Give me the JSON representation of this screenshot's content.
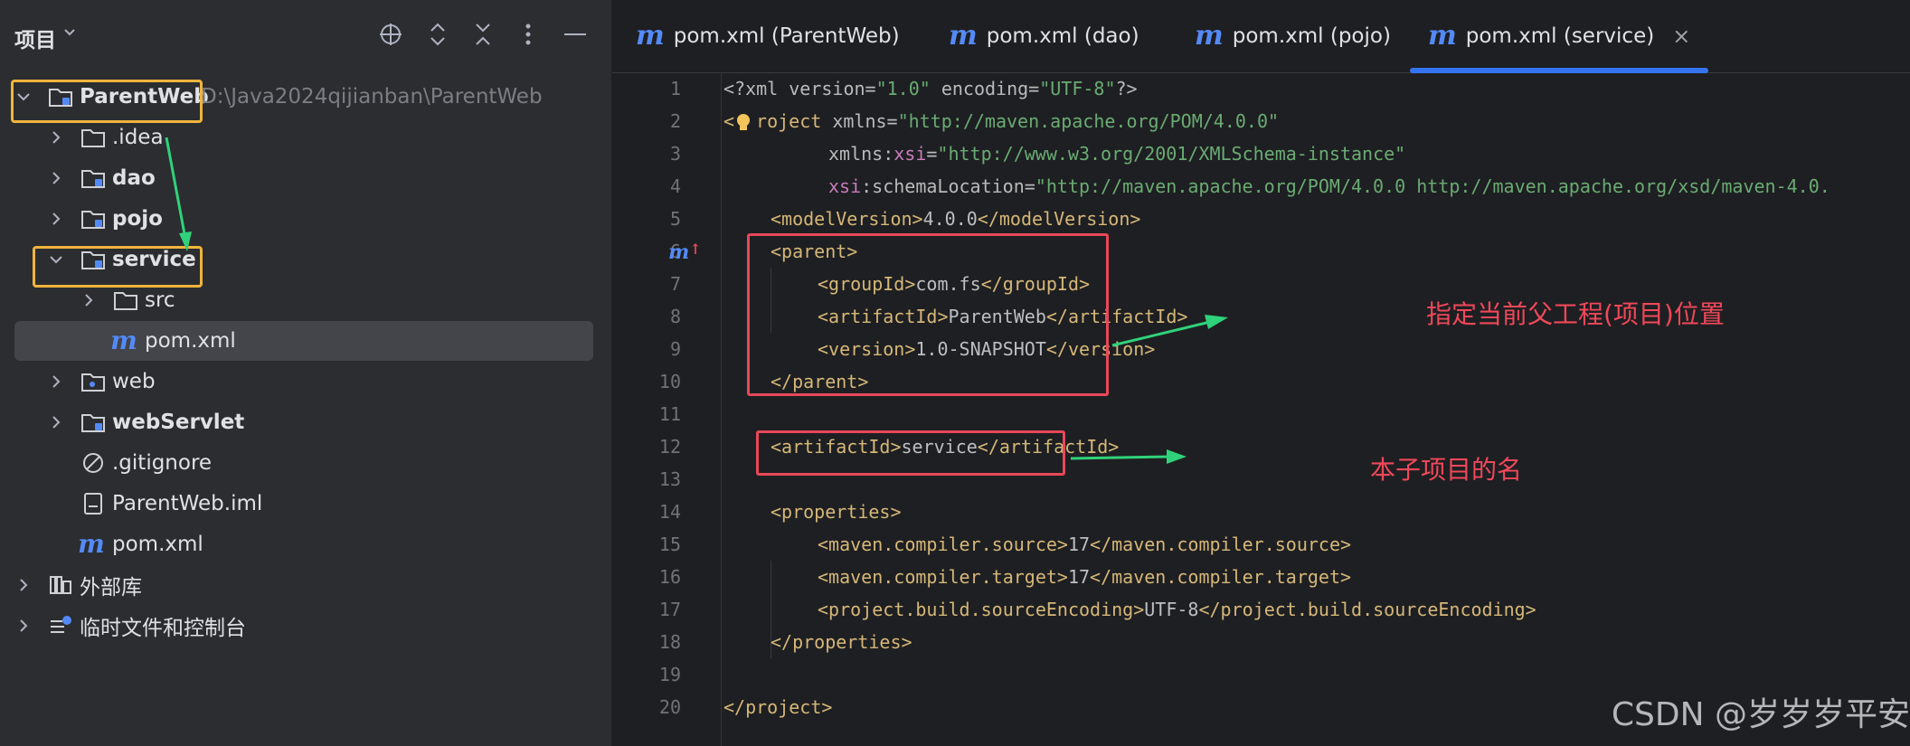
{
  "project_panel": {
    "title": "项目",
    "tree": [
      {
        "label": "ParentWeb",
        "path": "D:\\Java2024qijianban\\ParentWeb",
        "icon": "module-folder-icon"
      },
      {
        "label": ".idea",
        "icon": "folder-icon"
      },
      {
        "label": "dao",
        "icon": "module-folder-icon"
      },
      {
        "label": "pojo",
        "icon": "module-folder-icon"
      },
      {
        "label": "service",
        "icon": "module-folder-icon"
      },
      {
        "label": "src",
        "icon": "folder-icon"
      },
      {
        "label": "pom.xml",
        "icon": "maven-icon"
      },
      {
        "label": "web",
        "icon": "web-folder-icon"
      },
      {
        "label": "webServlet",
        "icon": "module-folder-icon"
      },
      {
        "label": ".gitignore",
        "icon": "ignore-file-icon"
      },
      {
        "label": "ParentWeb.iml",
        "icon": "iml-file-icon"
      },
      {
        "label": "pom.xml",
        "icon": "maven-icon"
      },
      {
        "label": "外部库",
        "icon": "library-icon"
      },
      {
        "label": "临时文件和控制台",
        "icon": "scratch-icon"
      }
    ]
  },
  "editor": {
    "tabs": [
      {
        "label": "pom.xml (ParentWeb)"
      },
      {
        "label": "pom.xml (dao)"
      },
      {
        "label": "pom.xml (pojo)"
      },
      {
        "label": "pom.xml (service)",
        "active": true
      }
    ],
    "close_glyph": "×",
    "line_numbers": [
      "1",
      "2",
      "3",
      "4",
      "5",
      "6",
      "7",
      "8",
      "9",
      "10",
      "11",
      "12",
      "13",
      "14",
      "15",
      "16",
      "17",
      "18",
      "19",
      "20"
    ],
    "code": {
      "l1": {
        "a": "<?xml version=",
        "b": "\"1.0\"",
        "c": " encoding=",
        "d": "\"UTF-8\"",
        "e": "?>"
      },
      "l2": {
        "a": "<",
        "b": "roject",
        "c": " xmlns=",
        "d": "\"http://maven.apache.org/POM/4.0.0\""
      },
      "l3": {
        "a": "xmlns:",
        "b": "xsi",
        "c": "=",
        "d": "\"http://www.w3.org/2001/XMLSchema-instance\""
      },
      "l4": {
        "a": "xsi",
        "b": ":schemaLocation=",
        "c": "\"http://maven.apache.org/POM/4.0.0 http://maven.apache.org/xsd/maven-4.0."
      },
      "l5": {
        "a": "<modelVersion>",
        "b": "4.0.0",
        "c": "</modelVersion>"
      },
      "l6": {
        "a": "<parent>"
      },
      "l7": {
        "a": "<groupId>",
        "b": "com.fs",
        "c": "</groupId>"
      },
      "l8": {
        "a": "<artifactId>",
        "b": "ParentWeb",
        "c": "</artifactId>"
      },
      "l9": {
        "a": "<version>",
        "b": "1.0-SNAPSHOT",
        "c": "</version>"
      },
      "l10": {
        "a": "</parent>"
      },
      "l12": {
        "a": "<artifactId>",
        "b": "service",
        "c": "</artifactId>"
      },
      "l14": {
        "a": "<properties>"
      },
      "l15": {
        "a": "<maven.compiler.source>",
        "b": "17",
        "c": "</maven.compiler.source>"
      },
      "l16": {
        "a": "<maven.compiler.target>",
        "b": "17",
        "c": "</maven.compiler.target>"
      },
      "l17": {
        "a": "<project.build.sourceEncoding>",
        "b": "UTF-8",
        "c": "</project.build.sourceEncoding>"
      },
      "l18": {
        "a": "</properties>"
      },
      "l20": {
        "a": "</project>"
      }
    }
  },
  "annotations": {
    "parent_note": "指定当前父工程(项目)位置",
    "artifact_note": "本子项目的名"
  },
  "watermark": "CSDN @岁岁岁平安",
  "colors": {
    "accent": "#3574f0",
    "highlight_box": "#f0b43c",
    "annotation_red": "#e84858",
    "arrow_green": "#2fd27a"
  }
}
